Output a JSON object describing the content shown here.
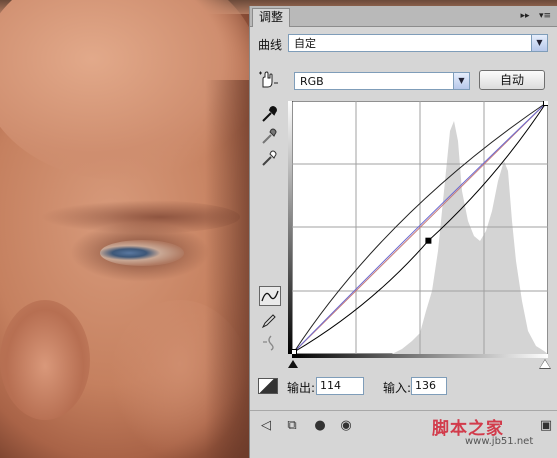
{
  "panel": {
    "tab_label": "调整",
    "collapse_glyph": "▸▸",
    "menu_glyph": "▾≡"
  },
  "curves": {
    "label": "曲线",
    "preset_value": "自定",
    "channel_value": "RGB",
    "auto_label": "自动"
  },
  "io": {
    "output_label": "输出:",
    "output_value": "114",
    "input_label": "输入:",
    "input_value": "136"
  },
  "icons": {
    "hand_tool": "on-image-adjust-icon",
    "black_eyedropper": "black-eyedropper-icon",
    "gray_eyedropper": "gray-eyedropper-icon",
    "white_eyedropper": "white-eyedropper-icon",
    "curve_tool": "curve-point-icon",
    "pencil_tool": "pencil-icon",
    "smooth_tool": "smooth-icon",
    "clip_warning": "clipping-icon"
  },
  "curve_points": [
    {
      "input": 0,
      "output": 0
    },
    {
      "input": 136,
      "output": 114
    },
    {
      "input": 255,
      "output": 255
    }
  ],
  "watermark": {
    "text": "脚本之家",
    "url": "www.jb51.net"
  },
  "colors": {
    "panel_bg": "#d6d6d6",
    "curve_line": "#000000",
    "baseline_line": "#c77a7a",
    "watermark": "#d23b4b"
  }
}
